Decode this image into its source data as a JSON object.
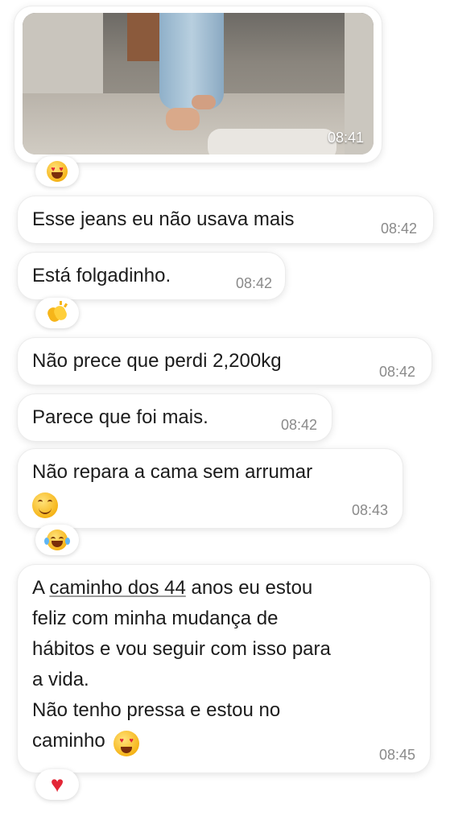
{
  "messages": [
    {
      "type": "image",
      "time": "08:41",
      "reaction": "heart-eyes-emoji"
    },
    {
      "text": "Esse jeans eu não usava mais",
      "time": "08:42"
    },
    {
      "text": "Está folgadinho.",
      "time": "08:42",
      "reaction": "clapping-hands-emoji"
    },
    {
      "text": "Não prece que perdi 2,200kg",
      "time": "08:42"
    },
    {
      "text": "Parece que foi mais.",
      "time": "08:42"
    },
    {
      "text": "Não repara a cama sem arrumar",
      "inline_emoji": "smiling-face-emoji",
      "time": "08:43",
      "reaction": "tears-of-joy-emoji"
    },
    {
      "lines": [
        {
          "pre": "A ",
          "link": "caminho dos 44",
          "post": " anos eu estou"
        },
        {
          "text": "feliz com minha mudança de"
        },
        {
          "text": "hábitos e vou seguir com isso para"
        },
        {
          "text": "a vida."
        },
        {
          "text": "Não tenho pressa e estou no"
        },
        {
          "text": "caminho",
          "inline_emoji": "heart-eyes-emoji"
        }
      ],
      "time": "08:45",
      "reaction": "red-heart-emoji"
    }
  ],
  "colors": {
    "bubble": "#ffffff",
    "text": "#1c1c1c",
    "timestamp": "#8a8a8a",
    "heart": "#e32636"
  }
}
